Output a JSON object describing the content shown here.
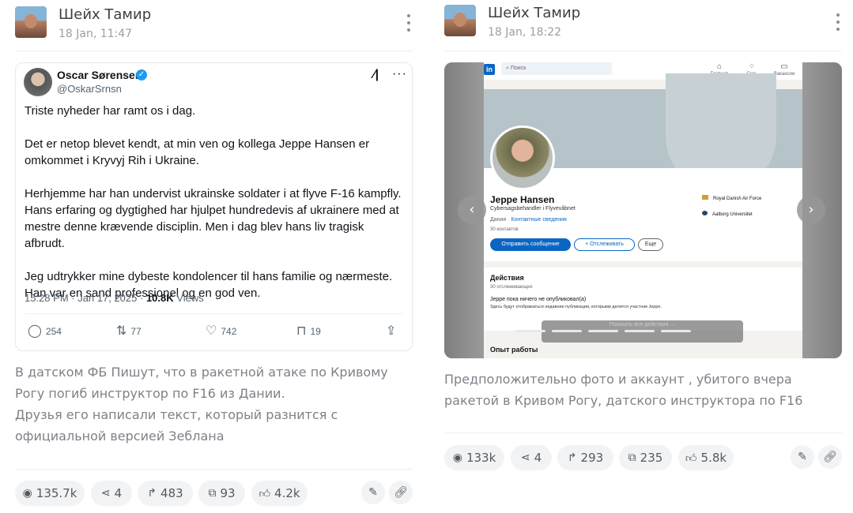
{
  "posts": [
    {
      "author": "Шейх Тамир",
      "date": "18 Jan, 11:47",
      "tweet": {
        "name": "Oscar Sørensen",
        "handle": "@OskarSrnsn",
        "paragraphs": [
          "Triste nyheder har ramt os i dag.",
          "Det er netop blevet kendt, at min ven og kollega Jeppe Hansen er omkommet i Kryvyj Rih i Ukraine.",
          "Herhjemme har han undervist ukrainske soldater i at flyve F-16 kampfly. Hans erfaring og dygtighed har hjulpet hundredevis af ukrainere med at mestre denne krævende disciplin. Men i dag blev hans liv tragisk afbrudt.",
          "Jeg udtrykker mine dybeste kondolencer til hans familie og nærmeste. Han var en sand professionel og en god ven."
        ],
        "time": "15:28 PM · Jan 17, 2025 · ",
        "views_count": "10.8K",
        "views_label": "Views",
        "actions": {
          "replies": "254",
          "reposts": "77",
          "likes": "742",
          "bookmarks": "19"
        }
      },
      "caption": [
        "В датском ФБ Пишут, что в ракетной атаке по Кривому Рогу погиб инструктор по F16 из Дании.",
        "Друзья его написали текст, который разнится с официальной версией Зеблана"
      ],
      "stats": {
        "views": "135.7k",
        "shares": "4",
        "forwards": "483",
        "comments": "93",
        "reactions": "4.2k"
      }
    },
    {
      "author": "Шейх Тамир",
      "date": "18 Jan, 18:22",
      "linkedin": {
        "search_placeholder": "Поиск",
        "nav": [
          "Главная",
          "Сеть",
          "Вакансии"
        ],
        "name": "Jeppe Hansen",
        "headline": "Cybersagsbehandler i Flyvevåbnet",
        "location": "Дания · ",
        "contact_link": "Контактные сведения",
        "connections": "30 контактов",
        "btn_message": "Отправить сообщение",
        "btn_follow": "+ Отслеживать",
        "btn_more": "Еще",
        "orgs": [
          "Royal Danish Air Force",
          "Aalborg Universitet"
        ],
        "activity_title": "Действия",
        "activity_followers": "30 отслеживающих",
        "activity_none": "Jeppe пока ничего не опубликовал(а)",
        "activity_sub": "Здесь будут отображаться недавние публикации, которыми делится участник Jeppe.",
        "show_all": "Показать все действия →",
        "experience_title": "Опыт работы"
      },
      "caption": [
        "Предположительно фото и аккаунт , убитого вчера ракетой в Кривом Рогу, датского инструктора по F16"
      ],
      "stats": {
        "views": "133k",
        "shares": "4",
        "forwards": "293",
        "comments": "235",
        "reactions": "5.8k"
      }
    }
  ],
  "colors": {
    "accent_blue": "#1d9bf0",
    "linkedin_blue": "#0a66c2",
    "pill_bg": "#f2f3f5"
  }
}
